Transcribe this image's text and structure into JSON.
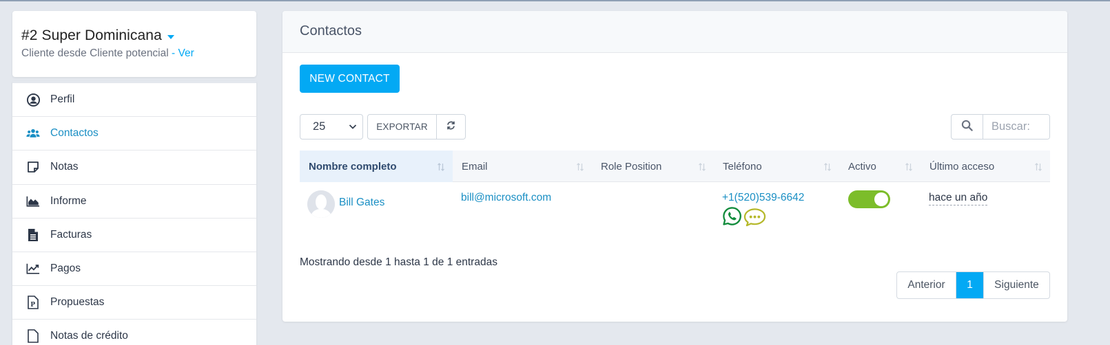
{
  "client": {
    "title": "#2 Super Dominicana",
    "subtitle": "Cliente desde Cliente potencial",
    "separator": " - ",
    "view_link": "Ver"
  },
  "sidebar": {
    "items": [
      {
        "label": "Perfil",
        "icon": "user-circle-icon",
        "active": false
      },
      {
        "label": "Contactos",
        "icon": "users-icon",
        "active": true
      },
      {
        "label": "Notas",
        "icon": "sticky-note-icon",
        "active": false
      },
      {
        "label": "Informe",
        "icon": "area-chart-icon",
        "active": false
      },
      {
        "label": "Facturas",
        "icon": "file-text-icon",
        "active": false
      },
      {
        "label": "Pagos",
        "icon": "line-chart-icon",
        "active": false
      },
      {
        "label": "Propuestas",
        "icon": "file-p-icon",
        "active": false
      },
      {
        "label": "Notas de crédito",
        "icon": "file-icon",
        "active": false
      }
    ]
  },
  "main": {
    "title": "Contactos",
    "new_contact_label": "NEW CONTACT",
    "page_length": "25",
    "export_label": "EXPORTAR",
    "search_placeholder": "Buscar:",
    "table": {
      "columns": [
        "Nombre completo",
        "Email",
        "Role Position",
        "Teléfono",
        "Activo",
        "Último acceso"
      ],
      "sorted_column": "Nombre completo",
      "rows": [
        {
          "name": "Bill Gates",
          "email": "bill@microsoft.com",
          "role": "",
          "phone": "+1(520)539-6642",
          "active": true,
          "last_access": "hace un año"
        }
      ]
    },
    "info": "Mostrando desde 1 hasta 1 de 1 entradas",
    "pagination": {
      "prev": "Anterior",
      "current": "1",
      "next": "Siguiente"
    }
  },
  "colors": {
    "accent": "#03a9f4",
    "link": "#1a8fc4",
    "toggle_on": "#7cbd2a",
    "whatsapp": "#128c3c",
    "sms": "#b5b82a"
  }
}
